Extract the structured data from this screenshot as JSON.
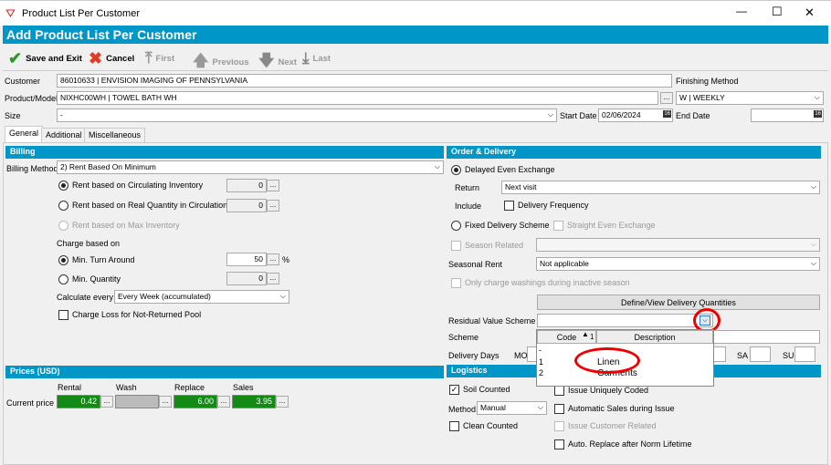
{
  "window": {
    "title": "Product List Per Customer",
    "minimize": "—",
    "maximize": "☐",
    "close": "✕"
  },
  "header": {
    "title": "Add Product List Per Customer"
  },
  "toolbar": {
    "save": "Save and Exit",
    "cancel": "Cancel",
    "first": "First",
    "previous": "Previous",
    "next": "Next",
    "last": "Last"
  },
  "fields": {
    "customer_label": "Customer",
    "customer": "86010633      | ENVISION IMAGING OF PENNSYLVANIA",
    "product_label": "Product/Model",
    "product": "NIXHC00WH     | TOWEL BATH WH",
    "size_label": "Size",
    "size": "-",
    "start_date_label": "Start Date",
    "start_date": "02/06/2024",
    "end_date_label": "End Date",
    "end_date": "",
    "finishing_label": "Finishing Method",
    "finishing": "W              | WEEKLY",
    "ellipsis": "...",
    "cal": "16"
  },
  "tabs": [
    "General",
    "Additional",
    "Miscellaneous"
  ],
  "billing": {
    "title": "Billing",
    "method_label": "Billing Method",
    "method": "2) Rent Based On Minimum",
    "opt1": "Rent based on Circulating Inventory",
    "opt1_val": "0",
    "opt2": "Rent based on Real Quantity in Circulation",
    "opt2_val": "0",
    "opt3": "Rent based on Max Inventory",
    "charge_label": "Charge based on",
    "turn": "Min. Turn Around",
    "turn_val": "50",
    "pct": "%",
    "minq": "Min. Quantity",
    "minq_val": "0",
    "calc_label": "Calculate every",
    "calc": "Every Week (accumulated)",
    "loss": "Charge Loss for Not-Returned Pool"
  },
  "prices": {
    "title": "Prices (USD)",
    "cols": [
      "Rental",
      "Wash",
      "Replace",
      "Sales"
    ],
    "row_label": "Current price",
    "rental": "0.42",
    "wash": "",
    "replace": "6.00",
    "sales": "3.95"
  },
  "order": {
    "title": "Order & Delivery",
    "delayed": "Delayed Even Exchange",
    "return_label": "Return",
    "return": "Next visit",
    "include_label": "Include",
    "freq": "Delivery Frequency",
    "fixed": "Fixed Delivery Scheme",
    "straight": "Straight Even Exchange",
    "seasonal_related": "Season Related",
    "seasonal_rent_label": "Seasonal Rent",
    "seasonal_rent": "Not applicable",
    "only_charge": "Only charge washings during inactive season",
    "define_btn": "Define/View Delivery Quantities",
    "residual_label": "Residual Value Scheme",
    "scheme_label": "Scheme",
    "days_label": "Delivery Days",
    "mo": "MO",
    "sa": "SA",
    "su": "SU"
  },
  "dropdown": {
    "col_code": "Code",
    "col_desc": "Description",
    "sort_idx": "1",
    "rows": [
      {
        "code": "-",
        "desc": ""
      },
      {
        "code": "1",
        "desc": "Linen"
      },
      {
        "code": "2",
        "desc": "Garments"
      }
    ]
  },
  "logistics": {
    "title": "Logistics",
    "soil": "Soil Counted",
    "method_label": "Method",
    "method": "Manual",
    "clean": "Clean Counted",
    "unique": "Issue Uniquely Coded",
    "auto_sales": "Automatic Sales during Issue",
    "issue_cust": "Issue Customer Related",
    "auto_replace": "Auto. Replace after Norm Lifetime"
  }
}
